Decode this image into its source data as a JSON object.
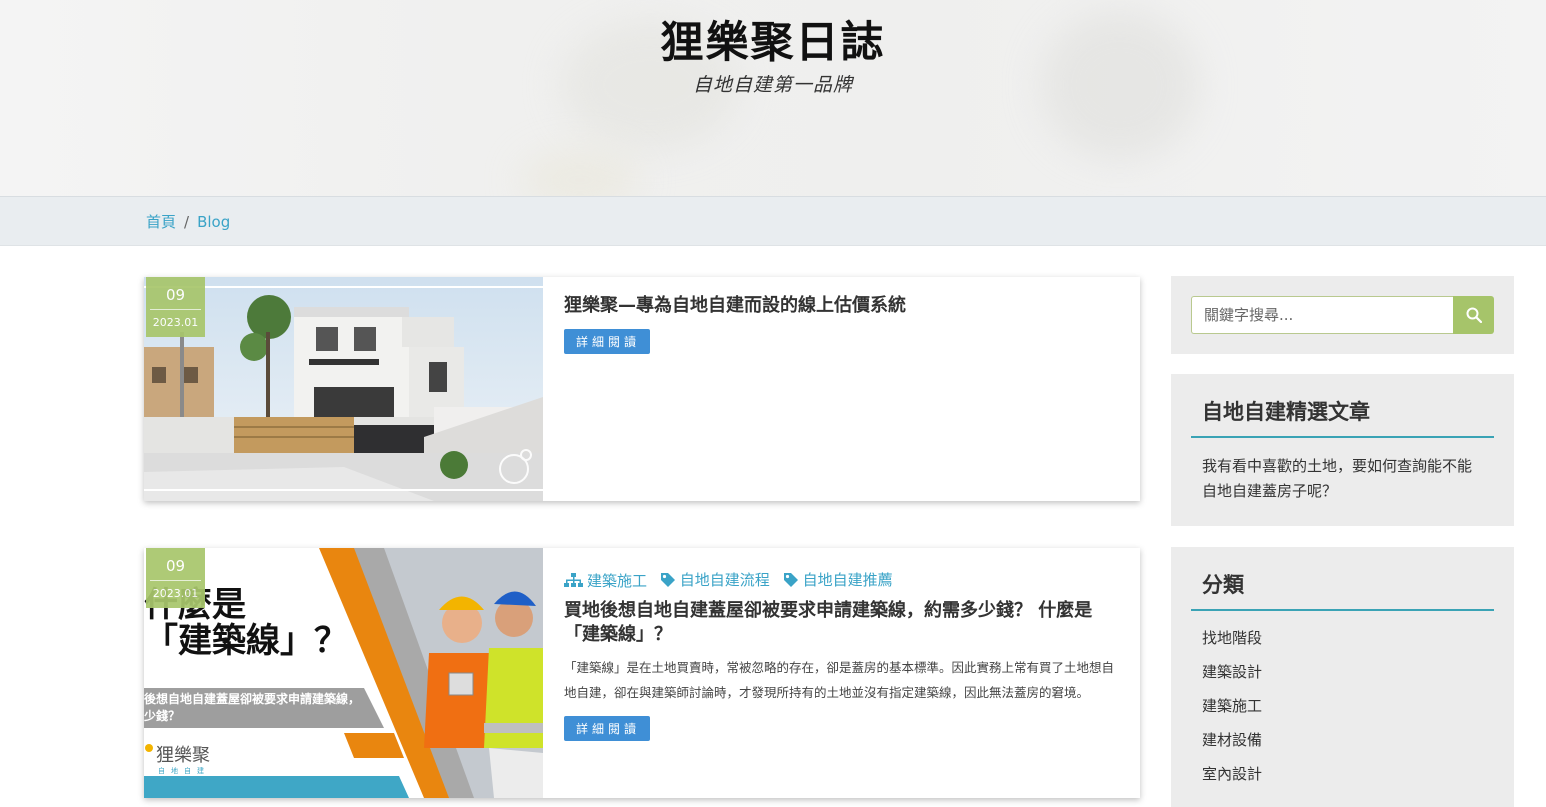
{
  "header": {
    "title": "狸樂聚日誌",
    "subtitle": "自地自建第一品牌"
  },
  "breadcrumb": {
    "home": "首頁",
    "separator": "/",
    "current": "Blog"
  },
  "posts": [
    {
      "day": "09",
      "year_month": "2023.01",
      "title": "狸樂聚—專為自地自建而設的線上估價系統",
      "button": "詳細閱讀"
    },
    {
      "day": "09",
      "year_month": "2023.01",
      "tags": [
        {
          "icon": "sitemap-icon",
          "label": "建築施工"
        },
        {
          "icon": "tag-icon",
          "label": "自地自建流程"
        },
        {
          "icon": "tag-icon",
          "label": "自地自建推薦"
        }
      ],
      "title": "買地後想自地自建蓋屋卻被要求申請建築線，約需多少錢？ 什麼是「建築線」？",
      "excerpt": "「建築線」是在土地買賣時，常被忽略的存在，卻是蓋房的基本標準。因此實務上常有買了土地想自地自建，卻在與建築師討論時，才發現所持有的土地並沒有指定建築線，因此無法蓋房的窘境。",
      "button": "詳細閱讀",
      "thumb_text": {
        "line1": "什麼是",
        "line2": "「建築線」？",
        "bar": "後想自地自建蓋屋卻被要求申請建築線，\n少錢？",
        "logo": "狸樂聚",
        "logo_sub": "自地自建"
      }
    }
  ],
  "sidebar": {
    "search": {
      "placeholder": "關鍵字搜尋..."
    },
    "featured": {
      "title": "自地自建精選文章",
      "items": [
        "我有看中喜歡的土地，要如何查詢能不能自地自建蓋房子呢？"
      ]
    },
    "categories": {
      "title": "分類",
      "items": [
        "找地階段",
        "建築設計",
        "建築施工",
        "建材設備",
        "室內設計"
      ]
    }
  },
  "colors": {
    "accent_blue": "#3aa3c7",
    "badge_green": "#a8c66c",
    "button_blue": "#3f8fd6",
    "widget_rule": "#3aa3b5"
  }
}
